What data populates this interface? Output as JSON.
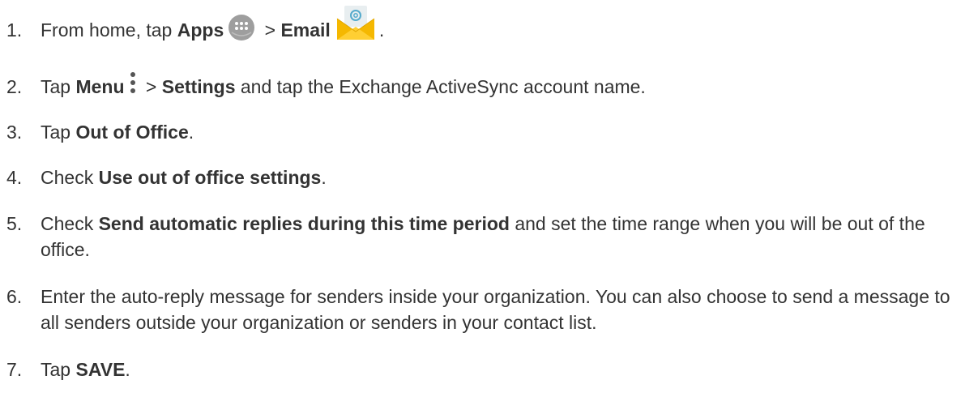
{
  "steps": [
    {
      "number": "1.",
      "parts": {
        "a": "From home, tap ",
        "b": "Apps",
        "c": " > ",
        "d": "Email",
        "e": "."
      }
    },
    {
      "number": "2.",
      "parts": {
        "a": "Tap ",
        "b": "Menu",
        "c": " > ",
        "d": "Settings",
        "e": " and tap the Exchange ActiveSync account name."
      }
    },
    {
      "number": "3.",
      "parts": {
        "a": "Tap ",
        "b": "Out of Office",
        "c": "."
      }
    },
    {
      "number": "4.",
      "parts": {
        "a": "Check ",
        "b": "Use out of office settings",
        "c": "."
      }
    },
    {
      "number": "5.",
      "parts": {
        "a": "Check ",
        "b": "Send automatic replies during this time period",
        "c": " and set the time range when you will be out of the office."
      }
    },
    {
      "number": "6.",
      "parts": {
        "a": "Enter the auto-reply message for senders inside your organization. You can also choose to send a message to all senders outside your organization or senders in your contact list."
      }
    },
    {
      "number": "7.",
      "parts": {
        "a": "Tap ",
        "b": "SAVE",
        "c": "."
      }
    }
  ],
  "icons": {
    "apps": "apps-icon",
    "email": "email-icon",
    "menu": "menu-icon"
  },
  "colors": {
    "text": "#333333",
    "apps_icon": "#9e9e9e",
    "email_envelope": "#f5b800",
    "email_paper": "#e8eef0",
    "email_at": "#55aacc"
  }
}
